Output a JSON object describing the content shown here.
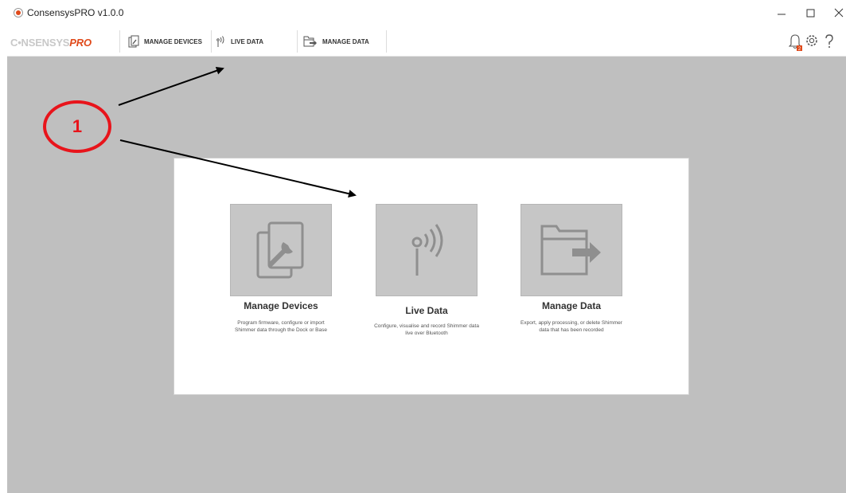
{
  "window": {
    "title": "ConsensysPRO v1.0.0"
  },
  "logo": {
    "main": "C•NSENSYS",
    "pro": "PRO"
  },
  "toolbar": {
    "items": [
      {
        "label": "MANAGE DEVICES",
        "icon": "manage-devices-icon"
      },
      {
        "label": "LIVE DATA",
        "icon": "live-data-icon"
      },
      {
        "label": "MANAGE DATA",
        "icon": "manage-data-icon"
      }
    ],
    "notifications_count": "2"
  },
  "tiles": [
    {
      "title": "Manage Devices",
      "description": "Program firmware, configure or import Shimmer data through the Dock or Base",
      "icon": "manage-devices-icon"
    },
    {
      "title": "Live Data",
      "description": "Configure, visualise and record Shimmer data live over Bluetooth",
      "icon": "live-data-icon"
    },
    {
      "title": "Manage Data",
      "description": "Export, apply processing, or delete Shimmer data that has been recorded",
      "icon": "manage-data-icon"
    }
  ],
  "annotation": {
    "label": "1",
    "color": "#e8141b"
  },
  "colors": {
    "brand": "#e04a1b",
    "workspace": "#bfbfbf",
    "tile": "#c6c6c6"
  }
}
